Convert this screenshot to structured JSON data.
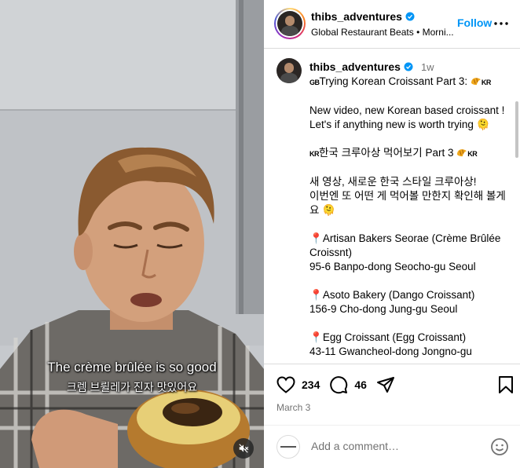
{
  "media": {
    "caption_en": "The crème brûlée  is so good",
    "caption_ko": "크렘 브륄레가 진자 맛있어요"
  },
  "header": {
    "username": "thibs_adventures",
    "subtitle": "Global Restaurant Beats • Morni...",
    "follow_label": "Follow",
    "more_icon": "more-horizontal-icon"
  },
  "post": {
    "username": "thibs_adventures",
    "time": "1w",
    "title_flag": "GB",
    "title_text": "Trying Korean Croissant Part 3: ",
    "title_flag_end": "KR",
    "para1": "New video, new Korean based croissant !\nLet's if anything new is worth trying 🫠",
    "ko_flag": "KR",
    "ko_title": "한국 크루아상 먹어보기 Part 3 ",
    "ko_flag_end": "KR",
    "para_ko": "새 영상, 새로운 한국 스타일 크루아상!\n이번엔 또 어떤 게 먹어볼 만한지 확인해 볼게요 🫠",
    "places": [
      {
        "name": "Artisan Bakers Seorae (Crème Brûlée Croissnt)",
        "address": "95-6 Banpo-dong Seocho-gu Seoul"
      },
      {
        "name": "Asoto Bakery (Dango Croissant)",
        "address": "156-9 Cho-dong Jung-gu Seoul"
      },
      {
        "name": "Egg Croissant (Egg Croissant)",
        "address": "43-11 Gwancheol-dong Jongno-gu"
      }
    ],
    "pin_glyph": "📍"
  },
  "actions": {
    "likes": "234",
    "comments": "46",
    "date": "March 3"
  },
  "comment_box": {
    "placeholder": "Add a comment…"
  }
}
